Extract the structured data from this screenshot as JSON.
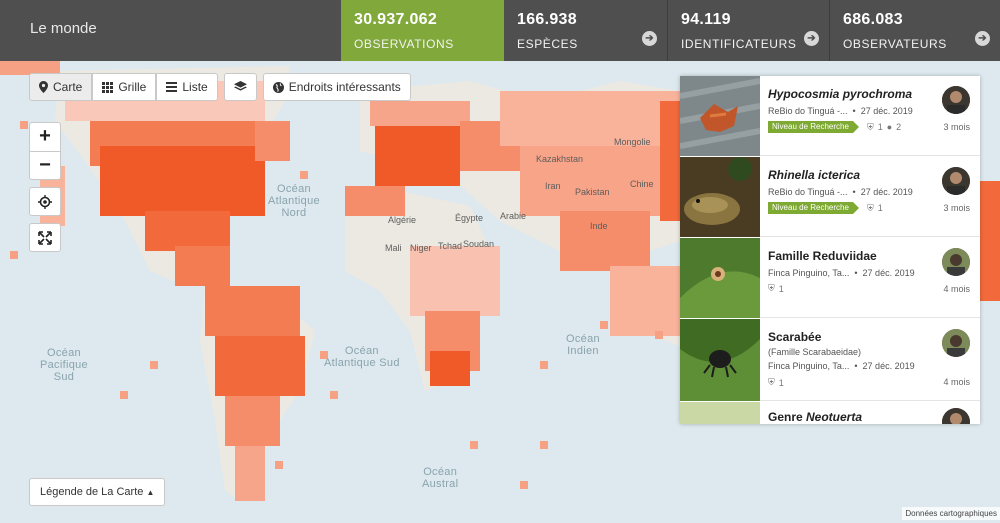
{
  "header": {
    "place": "Le monde",
    "stats": [
      {
        "value": "30.937.062",
        "label": "OBSERVATIONS",
        "active": true
      },
      {
        "value": "166.938",
        "label": "ESPÈCES"
      },
      {
        "value": "94.119",
        "label": "IDENTIFICATEURS"
      },
      {
        "value": "686.083",
        "label": "OBSERVATEURS"
      }
    ]
  },
  "views": {
    "map": "Carte",
    "grid": "Grille",
    "list": "Liste",
    "places": "Endroits intéressants"
  },
  "zoom": {
    "in": "+",
    "out": "−"
  },
  "legend_button": "Légende de La Carte",
  "attribution": "Données cartographiques",
  "map_labels": {
    "ocean_north_atlantic": "Océan\nAtlantique\nNord",
    "ocean_south_atlantic": "Océan\nAtlantique Sud",
    "ocean_south_pacific": "Océan\nPacifique\nSud",
    "ocean_indian": "Océan\nIndien",
    "ocean_austral": "Océan\nAustral",
    "places": [
      "Algérie",
      "Égypte",
      "Mali",
      "Niger",
      "Tchad",
      "Soudan",
      "Arabie",
      "Kazakhstan",
      "Iran",
      "Pakistan",
      "Inde",
      "Chine",
      "Mongolie"
    ]
  },
  "observations": [
    {
      "name_prefix": "",
      "name": "Hypocosmia pyrochroma",
      "name_italic": true,
      "subtitle": "",
      "place": "ReBio do Tinguá -...",
      "date": "27 déc. 2019",
      "quality": "Niveau de Recherche",
      "agreements": "1",
      "comments": "2",
      "ago": "3 mois"
    },
    {
      "name_prefix": "",
      "name": "Rhinella icterica",
      "name_italic": true,
      "subtitle": "",
      "place": "ReBio do Tinguá -...",
      "date": "27 déc. 2019",
      "quality": "Niveau de Recherche",
      "agreements": "1",
      "comments": "",
      "ago": "3 mois"
    },
    {
      "name_prefix": "",
      "name": "Famille Reduviidae",
      "name_italic": false,
      "subtitle": "",
      "place": "Finca Pinguino, Ta...",
      "date": "27 déc. 2019",
      "quality": "",
      "agreements": "1",
      "comments": "",
      "ago": "4 mois"
    },
    {
      "name_prefix": "",
      "name": "Scarabée",
      "name_italic": false,
      "subtitle": "(Famille Scarabaeidae)",
      "place": "Finca Pinguino, Ta...",
      "date": "27 déc. 2019",
      "quality": "",
      "agreements": "1",
      "comments": "",
      "ago": "4 mois"
    },
    {
      "name_prefix": "Genre ",
      "name": "Neotuerta",
      "name_italic": true,
      "subtitle": "",
      "place": "",
      "date": "",
      "quality": "",
      "agreements": "",
      "comments": "",
      "ago": ""
    }
  ],
  "colors": {
    "header": "#4f4f4f",
    "accent_green": "#80a83a",
    "heat_high": "#f05a28",
    "heat_low": "#f7b9a5",
    "ocean": "#dde9ee",
    "land": "#ece9e2"
  }
}
